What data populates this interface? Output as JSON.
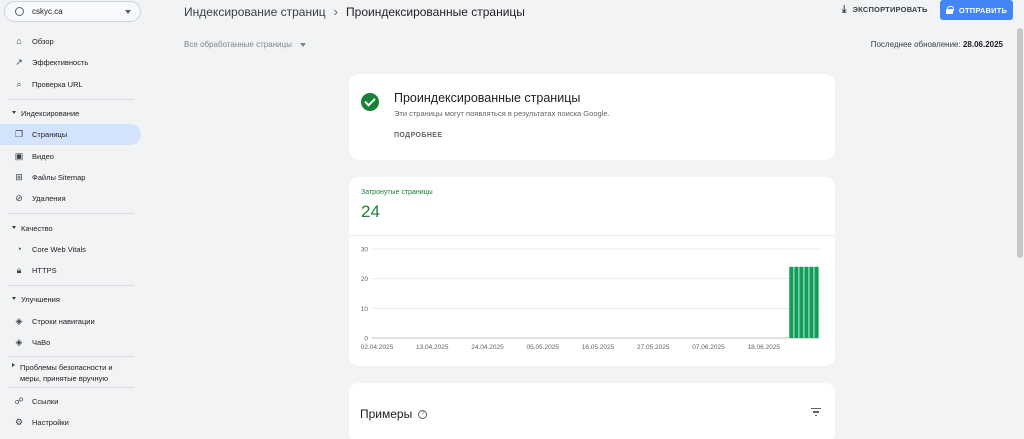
{
  "property": {
    "name": "cskyc.ca"
  },
  "sidebar": {
    "top_items": [
      {
        "label": "Обзор",
        "icon": "home-icon"
      },
      {
        "label": "Эффективность",
        "icon": "trending-icon"
      },
      {
        "label": "Проверка URL",
        "icon": "search-icon"
      }
    ],
    "sections": [
      {
        "title": "Индексирование",
        "items": [
          {
            "label": "Страницы",
            "icon": "pages-icon",
            "active": true
          },
          {
            "label": "Видео",
            "icon": "video-icon"
          },
          {
            "label": "Файлы Sitemap",
            "icon": "sitemap-icon"
          },
          {
            "label": "Удаления",
            "icon": "removals-icon"
          }
        ]
      },
      {
        "title": "Качество",
        "items": [
          {
            "label": "Core Web Vitals",
            "icon": "gauge-icon"
          },
          {
            "label": "HTTPS",
            "icon": "lock-icon"
          }
        ]
      },
      {
        "title": "Улучшения",
        "items": [
          {
            "label": "Строки навигации",
            "icon": "layers-icon"
          },
          {
            "label": "ЧаВо",
            "icon": "layers-icon"
          }
        ]
      }
    ],
    "collapsed_section": "Проблемы безопасности и меры, принятые вручную",
    "bottom_items": [
      {
        "label": "Ссылки",
        "icon": "links-icon"
      },
      {
        "label": "Настройки",
        "icon": "settings-icon"
      }
    ]
  },
  "header": {
    "breadcrumb_parent": "Индексирование страниц",
    "breadcrumb_current": "Проиндексированные страницы",
    "export_label": "ЭКСПОРТИРОВАТЬ",
    "send_label": "ОТПРАВИТЬ",
    "filter_label": "Все обработанные страницы",
    "updated_label": "Последнее обновление:",
    "updated_date": "28.06.2025"
  },
  "status_card": {
    "title": "Проиндексированные страницы",
    "subtitle": "Эти страницы могут появляться в результатах поиска Google.",
    "more_label": "ПОДРОБНЕЕ"
  },
  "affected_card": {
    "label": "Затронутые страницы",
    "count": "24"
  },
  "chart_data": {
    "type": "bar",
    "x_tick_labels": [
      "02.04.2025",
      "13.04.2025",
      "24.04.2025",
      "05.05.2025",
      "16.05.2025",
      "27.05.2025",
      "07.06.2025",
      "18.06.2025"
    ],
    "y_ticks": [
      0,
      10,
      20,
      30
    ],
    "ylim": [
      0,
      30
    ],
    "date_range": [
      "2025-04-01",
      "2025-06-28"
    ],
    "bars": [
      {
        "date": "2025-06-23",
        "value": 24
      },
      {
        "date": "2025-06-24",
        "value": 24
      },
      {
        "date": "2025-06-25",
        "value": 24
      },
      {
        "date": "2025-06-26",
        "value": 24
      },
      {
        "date": "2025-06-27",
        "value": 24
      },
      {
        "date": "2025-06-28",
        "value": 24
      }
    ],
    "bar_color": "#0f9d58",
    "grid": true
  },
  "examples_card": {
    "title": "Примеры"
  },
  "colors": {
    "accent": "#4285f4",
    "success": "#188038",
    "active_nav": "#d3e3fd"
  }
}
